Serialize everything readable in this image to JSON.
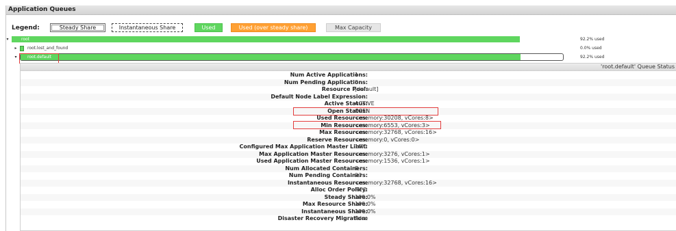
{
  "header": {
    "title": "Application Queues"
  },
  "legend": {
    "label": "Legend:",
    "steady_share": "Steady Share",
    "instantaneous_share": "Instantaneous Share",
    "used": "Used",
    "used_over": "Used (over steady share)",
    "max_capacity": "Max Capacity",
    "colors": {
      "used": "#5fd65f",
      "over": "#ffa033",
      "max": "#e6e6e6"
    }
  },
  "queues": [
    {
      "name": "root",
      "pct": "92.2% used",
      "used_fraction": 0.922,
      "expanded": true
    },
    {
      "name": "root.lost_and_found",
      "pct": "0.0% used",
      "used_fraction": 0.0,
      "expanded": false
    },
    {
      "name": "root.default",
      "pct": "92.2% used",
      "used_fraction": 0.922,
      "expanded": true
    }
  ],
  "detail": {
    "title": "'root.default' Queue Status",
    "rows": [
      {
        "key": "Num Active Applications:",
        "value": "1"
      },
      {
        "key": "Num Pending Applications:",
        "value": "0"
      },
      {
        "key": "Resource Pool:",
        "value": "[default]"
      },
      {
        "key": "Default Node Label Expression:",
        "value": ""
      },
      {
        "key": "Active Status:",
        "value": "ACTIVE"
      },
      {
        "key": "Open Status:",
        "value": "OPEN"
      },
      {
        "key": "Used Resources:",
        "value": "<memory:30208, vCores:8>"
      },
      {
        "key": "Min Resources:",
        "value": "<memory:6553, vCores:3>"
      },
      {
        "key": "Max Resources:",
        "value": "<memory:32768, vCores:16>"
      },
      {
        "key": "Reserve Resources:",
        "value": "<memory:0, vCores:0>"
      },
      {
        "key": "Configured Max Application Master Limit:",
        "value": "10.0"
      },
      {
        "key": "Max Application Master Resources:",
        "value": "<memory:3276, vCores:1>"
      },
      {
        "key": "Used Application Master Resources:",
        "value": "<memory:1536, vCores:1>"
      },
      {
        "key": "Num Allocated Containers:",
        "value": "8"
      },
      {
        "key": "Num Pending Containers:",
        "value": "93"
      },
      {
        "key": "Instantaneous Resources:",
        "value": "<memory:32768, vCores:16>"
      },
      {
        "key": "Alloc Order Policy:",
        "value": "FIFO"
      },
      {
        "key": "Steady Share:",
        "value": "100.0%"
      },
      {
        "key": "Max Resource Share:",
        "value": "100.0%"
      },
      {
        "key": "Instantaneous Share:",
        "value": "100.0%"
      },
      {
        "key": "Disaster Recovery Migration:",
        "value": "false"
      }
    ]
  }
}
